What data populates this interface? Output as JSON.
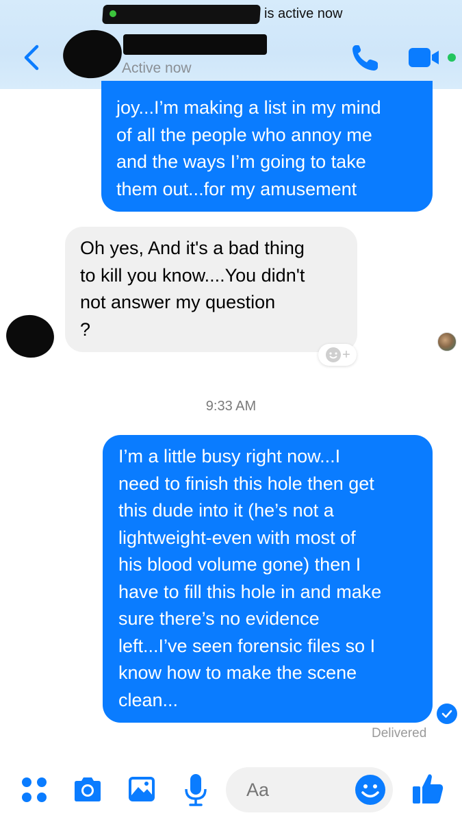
{
  "header": {
    "banner_text": "is active now",
    "active_status": "Active now",
    "accent_color": "#0a7cff",
    "online_color": "#22c55e"
  },
  "messages": [
    {
      "direction": "outgoing",
      "lines": [
        "joy...I’m making a list in my mind",
        "of all the people who annoy me",
        "and the ways I’m going to take",
        "them out...for my amusement"
      ]
    },
    {
      "direction": "incoming",
      "lines": [
        "Oh  yes, And it's a bad thing",
        "to kill you know....You didn't",
        "not answer my question",
        "?"
      ]
    },
    {
      "direction": "outgoing",
      "lines": [
        "I’m a little busy right now...I",
        "need to finish this hole then get",
        "this dude into it (he’s not a",
        "lightweight-even with most of",
        "his blood volume gone) then I",
        "have to fill this hole in and make",
        "sure there’s no evidence",
        "left...I’ve seen forensic files so I",
        "know how to make the scene",
        "clean..."
      ]
    }
  ],
  "timestamp": "9:33 AM",
  "delivery_status": "Delivered",
  "composer": {
    "placeholder": "Aa",
    "icons": [
      "apps-icon",
      "camera-icon",
      "gallery-icon",
      "microphone-icon",
      "emoji-icon",
      "thumbs-up-icon"
    ]
  },
  "reaction": {
    "icon": "add-reaction-icon",
    "label": "+"
  }
}
